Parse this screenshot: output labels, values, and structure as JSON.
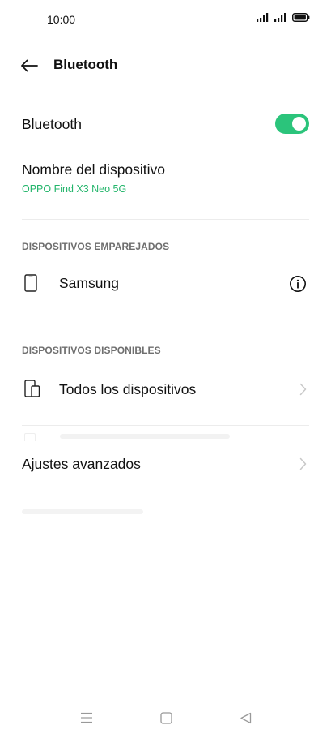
{
  "status_bar": {
    "time": "10:00",
    "icons": [
      "signal-icon",
      "signal-icon",
      "battery-icon"
    ]
  },
  "header": {
    "title": "Bluetooth",
    "back_icon": "back-arrow-icon"
  },
  "bluetooth": {
    "label": "Bluetooth",
    "enabled": true,
    "accent_color": "#2bc47b"
  },
  "device_name": {
    "title": "Nombre del dispositivo",
    "value": "OPPO Find X3 Neo 5G",
    "value_color": "#23b56b"
  },
  "paired": {
    "header": "DISPOSITIVOS EMPAREJADOS",
    "devices": [
      {
        "name": "Samsung",
        "icon": "phone-icon",
        "action_icon": "info-icon"
      }
    ]
  },
  "available": {
    "header": "DISPOSITIVOS DISPONIBLES",
    "items": [
      {
        "label": "Todos los dispositivos",
        "icon": "devices-icon",
        "action_icon": "chevron-right-icon"
      }
    ]
  },
  "advanced": {
    "label": "Ajustes avanzados",
    "action_icon": "chevron-right-icon"
  },
  "nav_bar": {
    "items": [
      "menu-icon",
      "home-icon",
      "back-triangle-icon"
    ]
  }
}
